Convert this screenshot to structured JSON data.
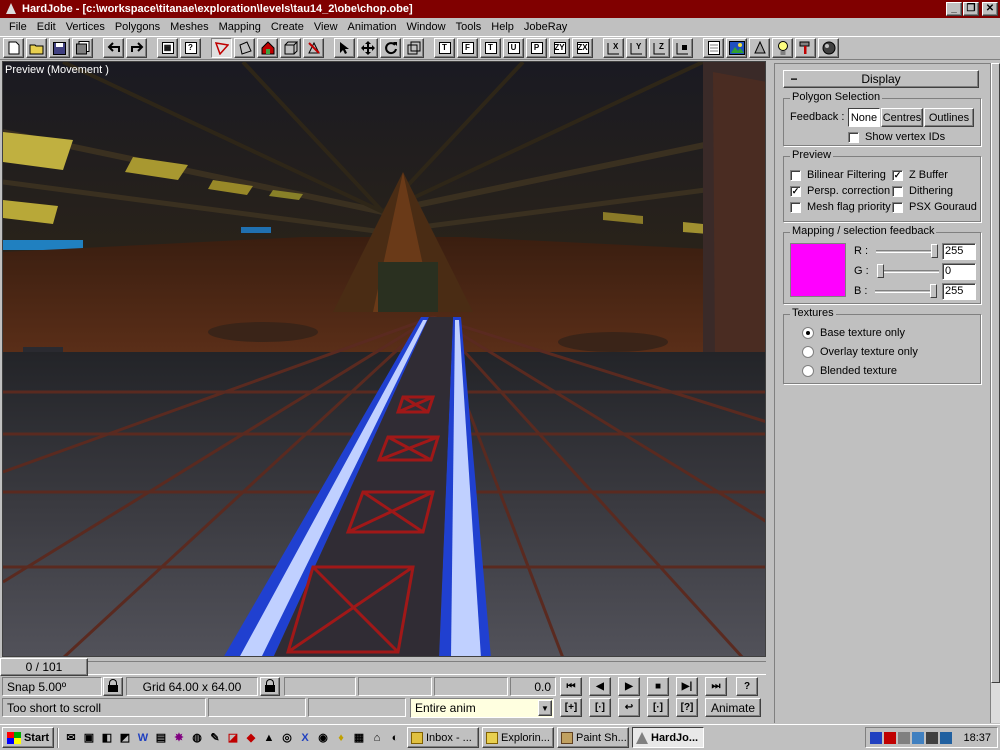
{
  "window": {
    "title": "HardJobe - [c:\\workspace\\titanae\\exploration\\levels\\tau14_2\\obe\\chop.obe]",
    "minimize_glyph": "_",
    "restore_glyph": "❐",
    "close_glyph": "✕"
  },
  "menu": [
    "File",
    "Edit",
    "Vertices",
    "Polygons",
    "Meshes",
    "Mapping",
    "Create",
    "View",
    "Animation",
    "Window",
    "Tools",
    "Help",
    "JobeRay"
  ],
  "toolbar": {
    "view_labels": [
      "T",
      "F",
      "T",
      "U",
      "P",
      "ZY",
      "ZX"
    ],
    "axis_labels": [
      "X",
      "Y",
      "Z"
    ]
  },
  "viewport": {
    "label": "Preview (Movement )"
  },
  "panel": {
    "rollout_title": "Display",
    "collapse_glyph": "−",
    "polygon_selection": {
      "title": "Polygon Selection",
      "feedback_label": "Feedback :",
      "options": [
        "None",
        "Centres",
        "Outlines"
      ],
      "selected": "None",
      "show_vertex_ids": "Show vertex IDs"
    },
    "preview": {
      "title": "Preview",
      "bilinear": "Bilinear Filtering",
      "zbuffer": "Z Buffer",
      "persp": "Persp. correction",
      "dithering": "Dithering",
      "meshflag": "Mesh flag priority",
      "psx": "PSX Gouraud",
      "check_glyph": "✓"
    },
    "mapping": {
      "title": "Mapping / selection feedback",
      "color": "#ff00ff",
      "r_label": "R :",
      "g_label": "G :",
      "b_label": "B :",
      "r": "255",
      "g": "0",
      "b": "255",
      "r_level": 1.0,
      "g_level": 0.0,
      "b_level": 1.0
    },
    "textures": {
      "title": "Textures",
      "base": "Base texture only",
      "overlay": "Overlay texture only",
      "blended": "Blended texture",
      "selected": "base"
    }
  },
  "timeline": {
    "frame": "0 / 101"
  },
  "status": {
    "snap": "Snap 5.00º",
    "grid": "Grid 64.00 x 64.00",
    "time": "0.0",
    "message": "Too short to scroll",
    "anim_select": "Entire anim",
    "animate": "Animate",
    "help_glyph": "?",
    "playback_glyphs": [
      "⏮",
      "◀",
      "▶",
      "■",
      "▶|",
      "⏭"
    ],
    "key_glyphs": [
      "[+]",
      "[·]",
      "↩",
      "[·]",
      "[?]"
    ]
  },
  "taskbar": {
    "start": "Start",
    "tasks": [
      "Inbox - ...",
      "Explorin...",
      "Paint Sh...",
      "HardJo..."
    ],
    "active_task": "HardJo...",
    "clock": "18:37",
    "quicklaunch": [
      "✉",
      "▣",
      "◧",
      "◩",
      "W",
      "▤",
      "✸",
      "◍",
      "✎",
      "◪",
      "◆",
      "▲",
      "◎",
      "X",
      "◉",
      "♦",
      "▦",
      "⌂",
      "◐"
    ]
  }
}
